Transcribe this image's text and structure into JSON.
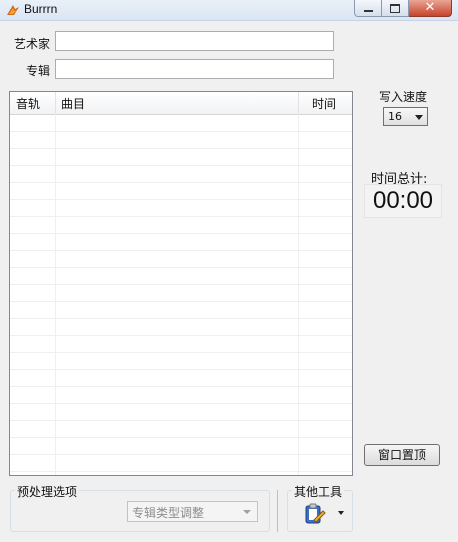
{
  "window": {
    "title": "Burrrn"
  },
  "form": {
    "artist_label": "艺术家",
    "album_label": "专辑",
    "artist_value": "",
    "album_value": ""
  },
  "tracklist": {
    "columns": [
      "音轨",
      "曲目",
      "时间"
    ],
    "rows": []
  },
  "speed": {
    "label": "写入速度",
    "value": "16"
  },
  "total": {
    "label": "时间总计:",
    "value": "00:00"
  },
  "buttons": {
    "window_reset": "窗口置顶"
  },
  "preprocess": {
    "label": "预处理选项",
    "combo_value": "专辑类型调整"
  },
  "tools": {
    "label": "其他工具"
  },
  "icons": [
    "burrrn-app-icon",
    "minimize-icon",
    "maximize-icon",
    "close-icon",
    "tools-clipboard-icon",
    "dropdown-arrow-icon"
  ]
}
